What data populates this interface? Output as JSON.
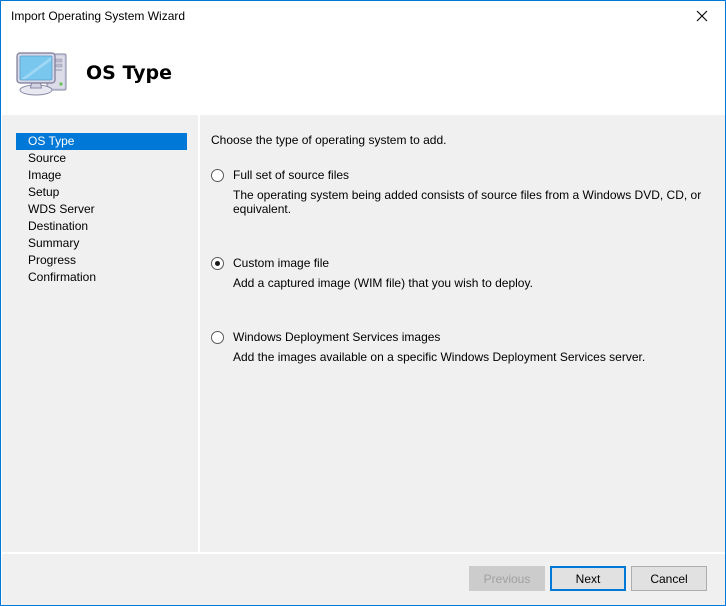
{
  "window": {
    "title": "Import Operating System Wizard",
    "close_icon": "close-icon",
    "accent_color": "#0078d7",
    "body_background": "#f0f0f0"
  },
  "header": {
    "icon": "computer-icon",
    "title": "OS Type"
  },
  "sidebar": {
    "items": [
      {
        "label": "OS Type",
        "selected": true
      },
      {
        "label": "Source",
        "selected": false
      },
      {
        "label": "Image",
        "selected": false
      },
      {
        "label": "Setup",
        "selected": false
      },
      {
        "label": "WDS Server",
        "selected": false
      },
      {
        "label": "Destination",
        "selected": false
      },
      {
        "label": "Summary",
        "selected": false
      },
      {
        "label": "Progress",
        "selected": false
      },
      {
        "label": "Confirmation",
        "selected": false
      }
    ]
  },
  "main": {
    "intro": "Choose the type of operating system to add.",
    "options": [
      {
        "label": "Full set of source files",
        "description": "The operating system being added consists of source files from a Windows DVD, CD, or equivalent.",
        "selected": false
      },
      {
        "label": "Custom image file",
        "description": "Add a captured image (WIM file) that you wish to deploy.",
        "selected": true
      },
      {
        "label": "Windows Deployment Services images",
        "description": "Add the images available on a specific Windows Deployment Services server.",
        "selected": false
      }
    ]
  },
  "footer": {
    "previous_label": "Previous",
    "next_label": "Next",
    "cancel_label": "Cancel"
  }
}
